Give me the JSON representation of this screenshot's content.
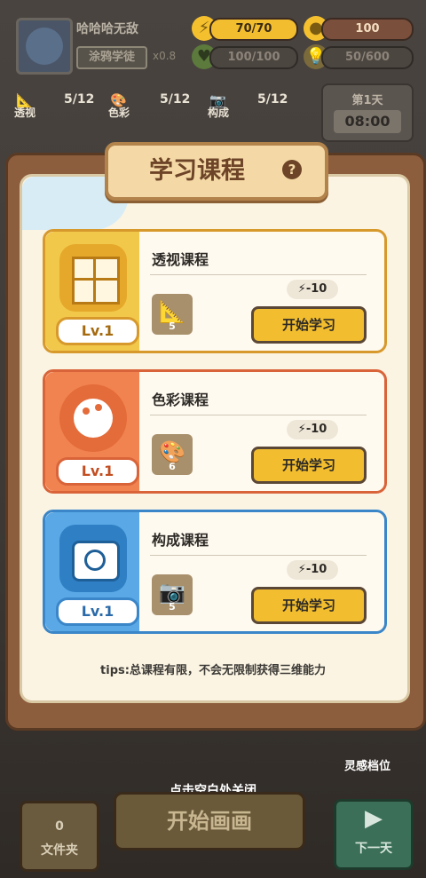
{
  "player": {
    "name": "哈哈哈无敌",
    "title": "涂鸦学徒",
    "multiplier": "x0.8"
  },
  "stats": {
    "energy": "70/70",
    "coins": "100",
    "health": "100/100",
    "idea": "50/600"
  },
  "skills": [
    {
      "label": "透视",
      "value": "5/12",
      "icon": "ruler-icon"
    },
    {
      "label": "色彩",
      "value": "5/12",
      "icon": "palette-icon"
    },
    {
      "label": "构成",
      "value": "5/12",
      "icon": "camera-icon"
    }
  ],
  "day": {
    "label": "第1天",
    "clock": "08:00"
  },
  "dialog": {
    "title": "学习课程",
    "help_glyph": "?",
    "tips": "tips:总课程有限，不会无限制获得三维能力"
  },
  "courses": [
    {
      "name": "透视课程",
      "level": "Lv.1",
      "item_count": "5",
      "cost": "-10",
      "button": "开始学习",
      "band_color": "#f2c84b",
      "accent": "#d7992c"
    },
    {
      "name": "色彩课程",
      "level": "Lv.1",
      "item_count": "6",
      "cost": "-10",
      "button": "开始学习",
      "band_color": "#f0834f",
      "accent": "#d9643a"
    },
    {
      "name": "构成课程",
      "level": "Lv.1",
      "item_count": "5",
      "cost": "-10",
      "button": "开始学习",
      "band_color": "#5aa9e6",
      "accent": "#3a86c8"
    }
  ],
  "bottom": {
    "close_hint": "点击空白处关闭",
    "start_painting": "开始画画",
    "folder_count": "0",
    "folder_label": "文件夹",
    "next_day": "下一天",
    "inspiration_slot": "灵感档位"
  }
}
